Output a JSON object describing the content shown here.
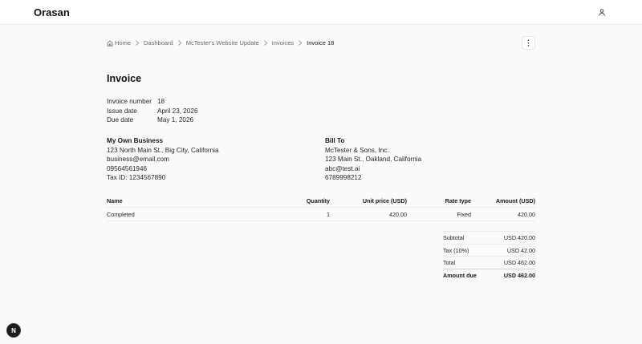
{
  "header": {
    "brand": "Orasan",
    "user_icon": "user-icon"
  },
  "breadcrumb": [
    {
      "label": "Home",
      "icon": "home-icon"
    },
    {
      "label": "Dashboard"
    },
    {
      "label": "McTester's Website Update"
    },
    {
      "label": "Invoices"
    },
    {
      "label": "Invoice 18"
    }
  ],
  "page": {
    "title": "Invoice",
    "more_icon": "more-vertical-icon"
  },
  "meta": [
    {
      "label": "Invoice number",
      "value": "18"
    },
    {
      "label": "Issue date",
      "value": "April 23, 2026"
    },
    {
      "label": "Due date",
      "value": "May 1, 2026"
    }
  ],
  "from": {
    "heading": "My Own Business",
    "lines": [
      "123 North Main St., Big City, California",
      "business@email.com",
      "09564561946",
      "Tax ID: 1234567890"
    ]
  },
  "to": {
    "heading": "Bill To",
    "lines": [
      "McTester & Sons, Inc.",
      "123 Main St., Oakland, California",
      "abc@test.ai",
      "6789998212"
    ]
  },
  "items": {
    "columns": [
      "Name",
      "Quantity",
      "Unit price (USD)",
      "Rate type",
      "Amount (USD)"
    ],
    "rows": [
      [
        "Completed",
        "1",
        "420.00",
        "Fixed",
        "420.00"
      ]
    ]
  },
  "totals": [
    {
      "label": "Subtotal",
      "value": "USD 420.00"
    },
    {
      "label": "Tax (10%)",
      "value": "USD 42.00"
    },
    {
      "label": "Total",
      "value": "USD 462.00"
    },
    {
      "label": "Amount due",
      "value": "USD 462.00"
    }
  ],
  "dev_badge": {
    "label": "N"
  }
}
